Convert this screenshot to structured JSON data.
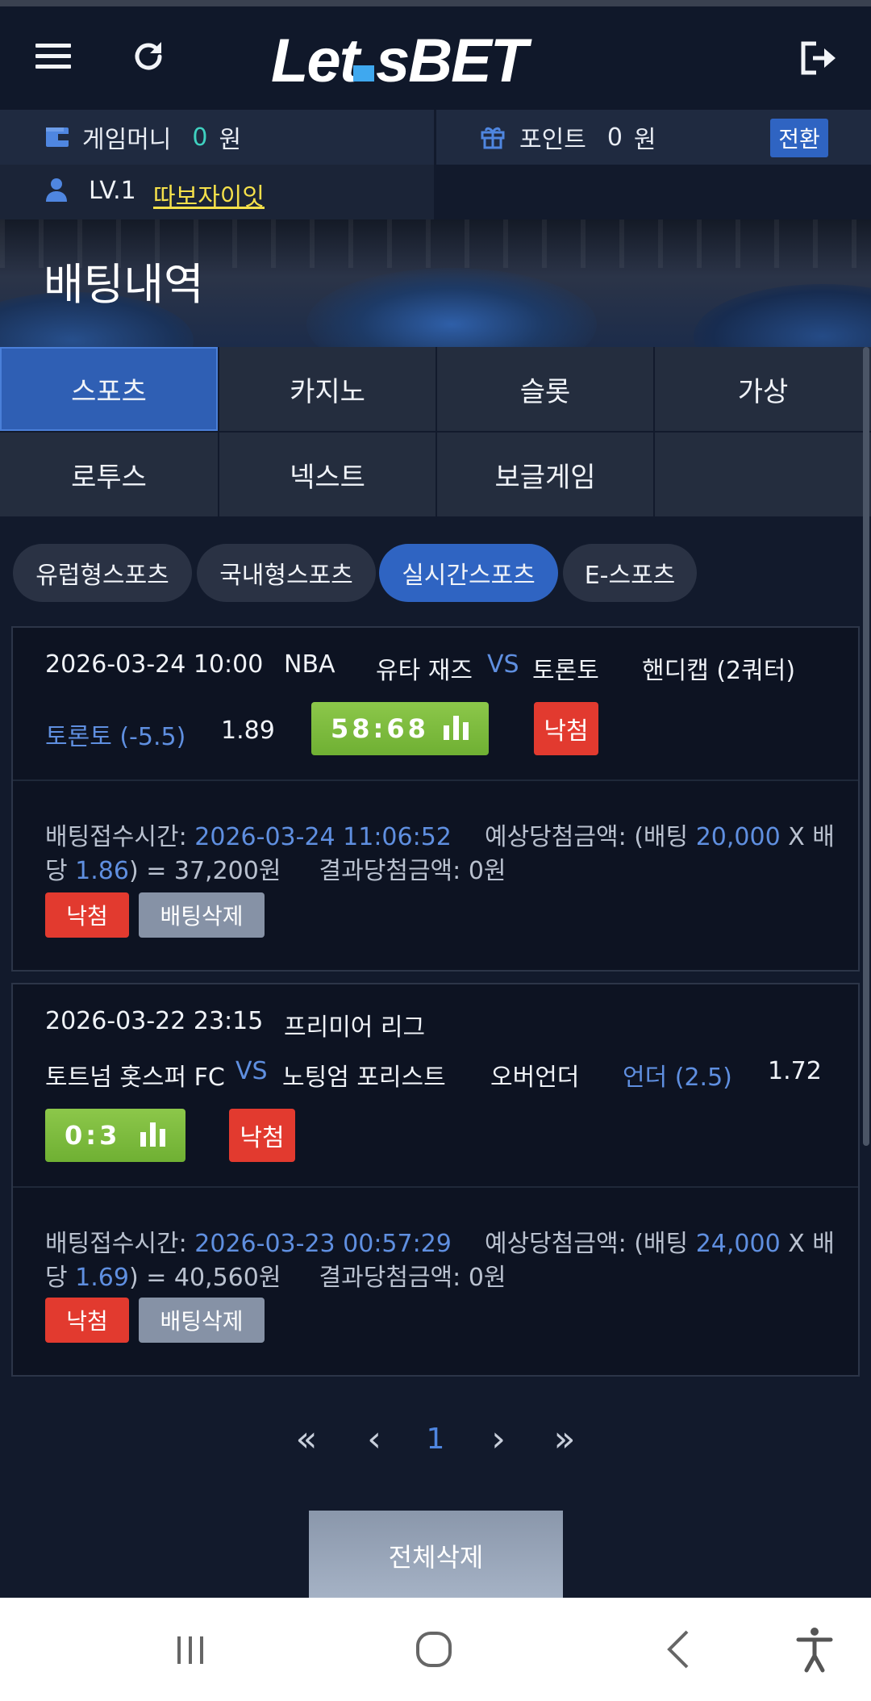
{
  "header": {
    "logo_left": "Let",
    "logo_right": "sBET",
    "menu_icon": "hamburger-menu-icon",
    "refresh_icon": "refresh-icon",
    "logout_icon": "logout-icon"
  },
  "account": {
    "game_money_label": "게임머니",
    "game_money_value": "0",
    "game_money_unit": "원",
    "points_label": "포인트",
    "points_value": "0",
    "points_unit": "원",
    "convert_label": "전환",
    "level": "LV.1",
    "username": "따보자이잇"
  },
  "page_title": "배팅내역",
  "categories": [
    "스포츠",
    "카지노",
    "슬롯",
    "가상",
    "로투스",
    "넥스트",
    "보글게임"
  ],
  "sub_tabs": [
    "유럽형스포츠",
    "국내형스포츠",
    "실시간스포츠",
    "E-스포츠"
  ],
  "bets": [
    {
      "datetime": "2026-03-24 10:00",
      "league": "NBA",
      "home": "유타 재즈",
      "vs": "VS",
      "away": "토론토",
      "market": "핸디캡 (2쿼터)",
      "pick": "토론토 (-5.5)",
      "odds": "1.89",
      "score": "58:68",
      "result": "낙첨",
      "time_label": "배팅접수시간:",
      "time_value": "2026-03-24 11:06:52",
      "expected_label": "예상당첨금액: (배팅",
      "stake": "20,000",
      "x_label": "X 배",
      "wrap_label": "당",
      "odds_applied": "1.86",
      "eq": ") = ",
      "expected_value": "37,200원",
      "result_amount_label": "결과당첨금액:",
      "result_amount_value": "0원",
      "status_btn": "낙첨",
      "delete_btn": "배팅삭제"
    },
    {
      "datetime": "2026-03-22 23:15",
      "league": "프리미어 리그",
      "home": "토트넘 홋스퍼 FC",
      "vs": "VS",
      "away": "노팅엄 포리스트",
      "market": "오버언더",
      "pick": "언더 (2.5)",
      "odds": "1.72",
      "score": "0:3",
      "result": "낙첨",
      "time_label": "배팅접수시간:",
      "time_value": "2026-03-23 00:57:29",
      "expected_label": "예상당첨금액: (배팅",
      "stake": "24,000",
      "x_label": "X 배",
      "wrap_label": "당",
      "odds_applied": "1.69",
      "eq": ") = ",
      "expected_value": "40,560원",
      "result_amount_label": "결과당첨금액:",
      "result_amount_value": "0원",
      "status_btn": "낙첨",
      "delete_btn": "배팅삭제"
    }
  ],
  "pagination": {
    "first": "«",
    "prev": "‹",
    "current": "1",
    "next": "›",
    "last": "»"
  },
  "delete_all_label": "전체삭제",
  "colors": {
    "background": "#121a2c",
    "accent_blue": "#2f5fb4",
    "link_blue": "#5f8fe0",
    "loss_red": "#e23a2f",
    "score_green": "#7dbb3e",
    "username_yellow": "#f5e04a"
  },
  "system_nav": {
    "recents_icon": "recent-apps-icon",
    "home_icon": "home-circle-icon",
    "back_icon": "back-icon",
    "accessibility_icon": "accessibility-icon"
  }
}
